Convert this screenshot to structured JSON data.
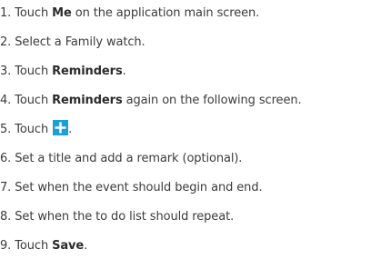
{
  "steps": [
    {
      "num": "1.",
      "pre": "Touch ",
      "bold": "Me",
      "post": " on the application main screen."
    },
    {
      "num": "2.",
      "text": "Select a Family watch."
    },
    {
      "num": "3.",
      "pre": "Touch ",
      "bold": "Reminders",
      "post": "."
    },
    {
      "num": "4.",
      "pre": "Touch ",
      "bold": "Reminders",
      "post": " again on the following screen."
    },
    {
      "num": "5.",
      "pre": "Touch ",
      "icon": "plus-icon",
      "post": "."
    },
    {
      "num": "6.",
      "text": "Set a title and add a remark (optional)."
    },
    {
      "num": "7.",
      "text": "Set when the event should begin and end."
    },
    {
      "num": "8.",
      "text": "Set when the to do list should repeat."
    },
    {
      "num": "9.",
      "pre": "Touch ",
      "bold": "Save",
      "post": "."
    }
  ],
  "colors": {
    "text": "#3b3b3b",
    "icon_blue": "#1a9fd9"
  }
}
